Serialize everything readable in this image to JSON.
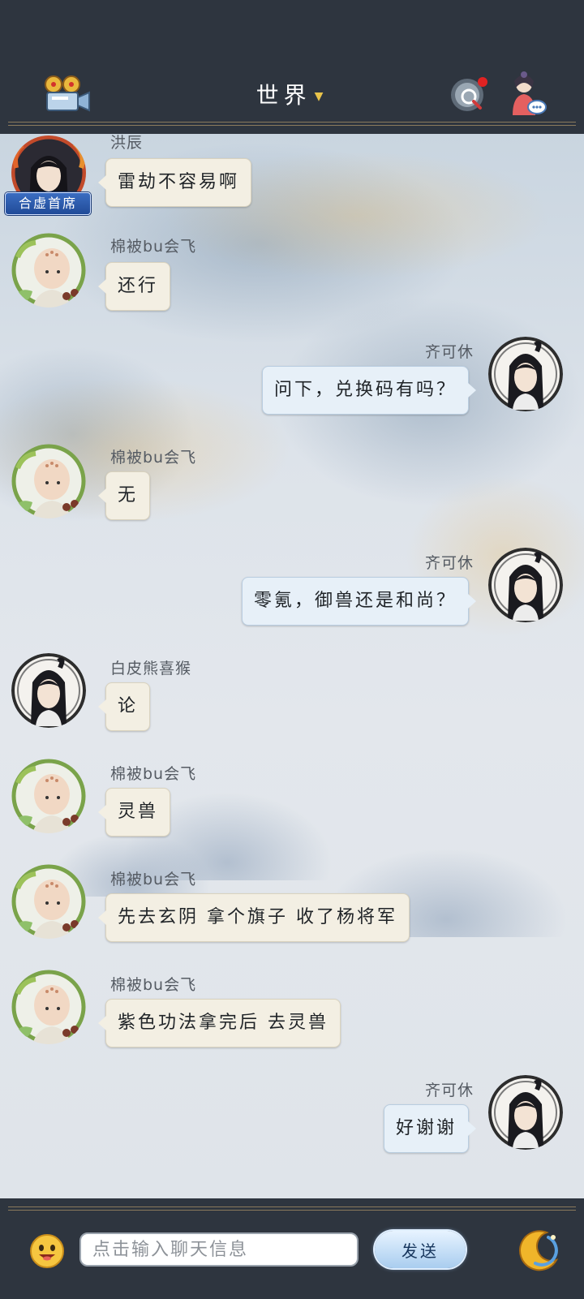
{
  "header": {
    "title": "世界",
    "title_caret": "▼",
    "left_icon": "camera-reel-icon",
    "right_icons": [
      "search-recall-icon",
      "character-chat-icon"
    ]
  },
  "messages": [
    {
      "side": "left",
      "avatar": "avatar-long-hair-flame",
      "name": "洪辰",
      "text": "雷劫不容易啊",
      "badge": "合虚首席"
    },
    {
      "side": "left",
      "avatar": "avatar-monk",
      "name": "棉被bu会飞",
      "text": "还行"
    },
    {
      "side": "right",
      "avatar": "avatar-ponytail",
      "name": "齐可休",
      "text": "问下，兑换码有吗？"
    },
    {
      "side": "left",
      "avatar": "avatar-monk",
      "name": "棉被bu会飞",
      "text": "无"
    },
    {
      "side": "right",
      "avatar": "avatar-ponytail",
      "name": "齐可休",
      "text": "零氪，御兽还是和尚？"
    },
    {
      "side": "left",
      "avatar": "avatar-ponytail",
      "name": "白皮熊喜猴",
      "text": "论"
    },
    {
      "side": "left",
      "avatar": "avatar-monk",
      "name": "棉被bu会飞",
      "text": "灵兽"
    },
    {
      "side": "left",
      "avatar": "avatar-monk",
      "name": "棉被bu会飞",
      "text": "先去玄阴 拿个旗子 收了杨将军"
    },
    {
      "side": "left",
      "avatar": "avatar-monk",
      "name": "棉被bu会飞",
      "text": "紫色功法拿完后 去灵兽"
    },
    {
      "side": "right",
      "avatar": "avatar-ponytail",
      "name": "齐可休",
      "text": "好谢谢"
    }
  ],
  "input": {
    "placeholder": "点击输入聊天信息",
    "value": ""
  },
  "send_label": "发送",
  "colors": {
    "bar_bg": "#2e353f",
    "left_bubble": "#f3efe3",
    "right_bubble": "#e7f0f8",
    "badge_blue": "#214b98"
  }
}
